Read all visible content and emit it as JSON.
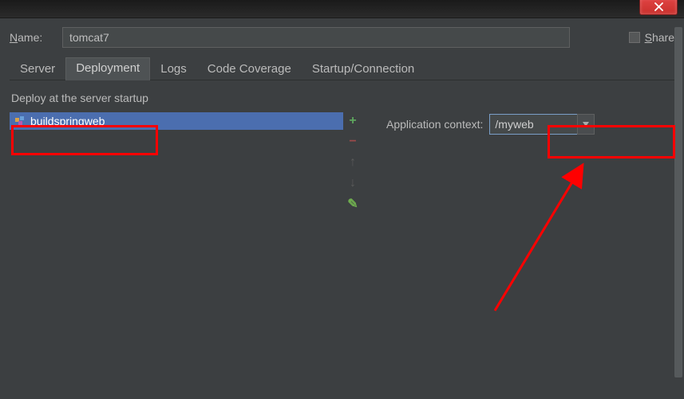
{
  "titlebar": {
    "close_title": "Close"
  },
  "name_row": {
    "label": "Name:",
    "value": "tomcat7",
    "share_label": "Share"
  },
  "tabs": [
    {
      "id": "server",
      "label": "Server",
      "active": false
    },
    {
      "id": "deployment",
      "label": "Deployment",
      "active": true
    },
    {
      "id": "logs",
      "label": "Logs",
      "active": false
    },
    {
      "id": "coverage",
      "label": "Code Coverage",
      "active": false
    },
    {
      "id": "startup",
      "label": "Startup/Connection",
      "active": false
    }
  ],
  "deployment": {
    "section_title": "Deploy at the server startup",
    "artifacts": [
      {
        "name": "buildspringweb"
      }
    ],
    "context_label": "Application context:",
    "context_value": "/myweb"
  },
  "tool_labels": {
    "add": "+",
    "remove": "−",
    "up": "↑",
    "down": "↓",
    "edit": "✎"
  },
  "colors": {
    "selection": "#4b6eaf",
    "annotation": "#ff0000"
  }
}
